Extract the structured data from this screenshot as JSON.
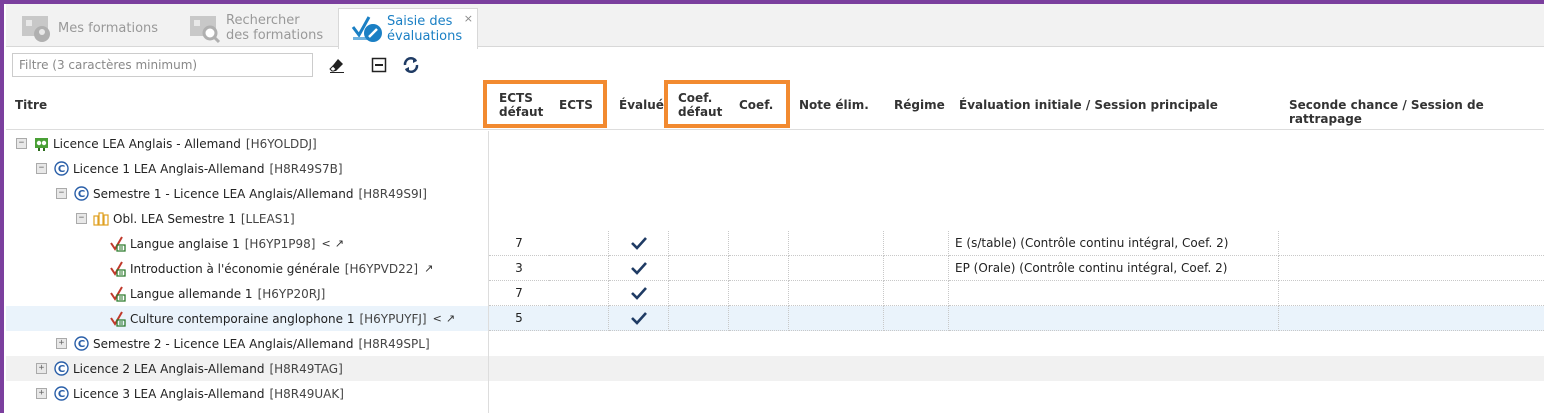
{
  "tabs": [
    {
      "label": "Mes formations",
      "active": false
    },
    {
      "label_line1": "Rechercher",
      "label_line2": "des formations",
      "active": false
    },
    {
      "label_line1": "Saisie des",
      "label_line2": "évaluations",
      "active": true,
      "close": "×"
    }
  ],
  "toolbar": {
    "filter_placeholder": "Filtre (3 caractères minimum)"
  },
  "columns": {
    "titre": "Titre",
    "ects_defaut_1": "ECTS",
    "ects_defaut_2": "défaut",
    "ects": "ECTS",
    "evalue": "Évalué",
    "coef_defaut_1": "Coef.",
    "coef_defaut_2": "défaut",
    "coef": "Coef.",
    "note_elim": "Note élim.",
    "regime": "Régime",
    "eval_initiale": "Évaluation initiale / Session principale",
    "seconde_chance": "Seconde chance / Session de rattrapage"
  },
  "tree": [
    {
      "label": "Licence LEA Anglais - Allemand",
      "code": "[H6YOLDDJ]",
      "expander": "−"
    },
    {
      "label": "Licence 1 LEA Anglais-Allemand",
      "code": "[H8R49S7B]",
      "expander": "−"
    },
    {
      "label": "Semestre 1 - Licence LEA Anglais/Allemand",
      "code": "[H8R49S9I]",
      "expander": "−"
    },
    {
      "label": "Obl. LEA Semestre 1",
      "code": "[LLEAS1]",
      "expander": "−"
    },
    {
      "label": "Langue anglaise 1",
      "code": "[H6YP1P98]",
      "ects_defaut": "7",
      "evaluation_initiale": "E (s/table) (Contrôle continu intégral, Coef. 2)"
    },
    {
      "label": "Introduction à l'économie générale",
      "code": "[H6YPVD22]",
      "ects_defaut": "3",
      "evaluation_initiale": "EP (Orale) (Contrôle continu intégral, Coef. 2)"
    },
    {
      "label": "Langue allemande 1",
      "code": "[H6YP20RJ]",
      "ects_defaut": "7",
      "evaluation_initiale": ""
    },
    {
      "label": "Culture contemporaine anglophone 1",
      "code": "[H6YPUYFJ]",
      "ects_defaut": "5",
      "evaluation_initiale": ""
    },
    {
      "label": "Semestre 2 - Licence LEA Anglais/Allemand",
      "code": "[H8R49SPL]",
      "expander": "+"
    },
    {
      "label": "Licence 2 LEA Anglais-Allemand",
      "code": "[H8R49TAG]",
      "expander": "+"
    },
    {
      "label": "Licence 3 LEA Anglais-Allemand",
      "code": "[H8R49UAK]",
      "expander": "+"
    }
  ],
  "colors": {
    "accent": "#1a7fc4",
    "highlight": "#f28a30",
    "frame": "#7b3f9e"
  }
}
